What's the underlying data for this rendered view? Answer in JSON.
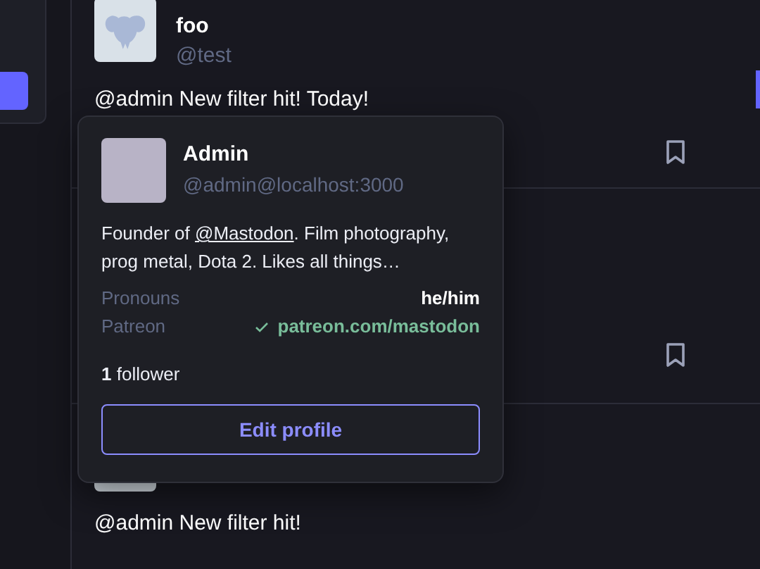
{
  "posts": [
    {
      "display_name": "foo",
      "handle": "@test",
      "content": "@admin New filter hit! Today!",
      "bookmarked": false
    },
    {
      "bookmarked": false
    },
    {
      "content": "@admin New filter hit!"
    }
  ],
  "hover_card": {
    "name": "Admin",
    "handle": "@admin@localhost:3000",
    "bio_before": "Founder of ",
    "bio_link": "@Mastodon",
    "bio_after": ". Film photography, prog metal, Dota 2. Likes all things…",
    "fields": [
      {
        "label": "Pronouns",
        "value": "he/him",
        "verified": false
      },
      {
        "label": "Patreon",
        "value": "patreon.com/mastodon",
        "verified": true
      }
    ],
    "follower_count": "1",
    "follower_label": "follower",
    "button": "Edit profile"
  }
}
